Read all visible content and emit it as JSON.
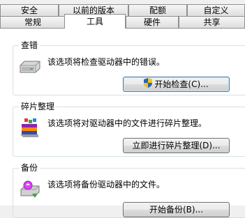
{
  "tabs_row1": [
    {
      "label": "安全"
    },
    {
      "label": "以前的版本"
    },
    {
      "label": "配额"
    },
    {
      "label": "自定义"
    }
  ],
  "tabs_row2": [
    {
      "label": "常规"
    },
    {
      "label": "工具"
    },
    {
      "label": "硬件"
    },
    {
      "label": "共享"
    }
  ],
  "active_tab": "工具",
  "groups": {
    "check": {
      "title": "查错",
      "description": "该选项将检查驱动器中的错误。",
      "button": "开始检查(C)...",
      "icon": "disk-drive-icon"
    },
    "defrag": {
      "title": "碎片整理",
      "description": "该选项将对驱动器中的文件进行碎片整理。",
      "button": "立即进行碎片整理(D)...",
      "icon": "defragment-icon"
    },
    "backup": {
      "title": "备份",
      "description": "该选项将备份驱动器中的文件。",
      "button": "开始备份(B)...",
      "icon": "backup-icon"
    }
  },
  "colors": {
    "accent": "#3c7fb1",
    "group_border": "#d5dfe5",
    "panel_bg": "#ffffff"
  }
}
